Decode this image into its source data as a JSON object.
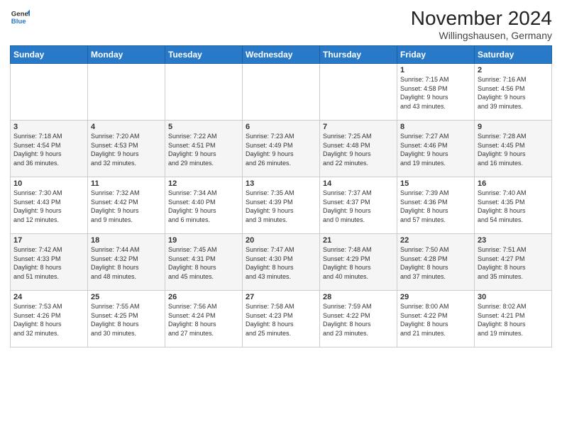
{
  "header": {
    "logo": {
      "general": "General",
      "blue": "Blue"
    },
    "title": "November 2024",
    "location": "Willingshausen, Germany"
  },
  "weekdays": [
    "Sunday",
    "Monday",
    "Tuesday",
    "Wednesday",
    "Thursday",
    "Friday",
    "Saturday"
  ],
  "weeks": [
    [
      {
        "day": "",
        "info": ""
      },
      {
        "day": "",
        "info": ""
      },
      {
        "day": "",
        "info": ""
      },
      {
        "day": "",
        "info": ""
      },
      {
        "day": "",
        "info": ""
      },
      {
        "day": "1",
        "info": "Sunrise: 7:15 AM\nSunset: 4:58 PM\nDaylight: 9 hours\nand 43 minutes."
      },
      {
        "day": "2",
        "info": "Sunrise: 7:16 AM\nSunset: 4:56 PM\nDaylight: 9 hours\nand 39 minutes."
      }
    ],
    [
      {
        "day": "3",
        "info": "Sunrise: 7:18 AM\nSunset: 4:54 PM\nDaylight: 9 hours\nand 36 minutes."
      },
      {
        "day": "4",
        "info": "Sunrise: 7:20 AM\nSunset: 4:53 PM\nDaylight: 9 hours\nand 32 minutes."
      },
      {
        "day": "5",
        "info": "Sunrise: 7:22 AM\nSunset: 4:51 PM\nDaylight: 9 hours\nand 29 minutes."
      },
      {
        "day": "6",
        "info": "Sunrise: 7:23 AM\nSunset: 4:49 PM\nDaylight: 9 hours\nand 26 minutes."
      },
      {
        "day": "7",
        "info": "Sunrise: 7:25 AM\nSunset: 4:48 PM\nDaylight: 9 hours\nand 22 minutes."
      },
      {
        "day": "8",
        "info": "Sunrise: 7:27 AM\nSunset: 4:46 PM\nDaylight: 9 hours\nand 19 minutes."
      },
      {
        "day": "9",
        "info": "Sunrise: 7:28 AM\nSunset: 4:45 PM\nDaylight: 9 hours\nand 16 minutes."
      }
    ],
    [
      {
        "day": "10",
        "info": "Sunrise: 7:30 AM\nSunset: 4:43 PM\nDaylight: 9 hours\nand 12 minutes."
      },
      {
        "day": "11",
        "info": "Sunrise: 7:32 AM\nSunset: 4:42 PM\nDaylight: 9 hours\nand 9 minutes."
      },
      {
        "day": "12",
        "info": "Sunrise: 7:34 AM\nSunset: 4:40 PM\nDaylight: 9 hours\nand 6 minutes."
      },
      {
        "day": "13",
        "info": "Sunrise: 7:35 AM\nSunset: 4:39 PM\nDaylight: 9 hours\nand 3 minutes."
      },
      {
        "day": "14",
        "info": "Sunrise: 7:37 AM\nSunset: 4:37 PM\nDaylight: 9 hours\nand 0 minutes."
      },
      {
        "day": "15",
        "info": "Sunrise: 7:39 AM\nSunset: 4:36 PM\nDaylight: 8 hours\nand 57 minutes."
      },
      {
        "day": "16",
        "info": "Sunrise: 7:40 AM\nSunset: 4:35 PM\nDaylight: 8 hours\nand 54 minutes."
      }
    ],
    [
      {
        "day": "17",
        "info": "Sunrise: 7:42 AM\nSunset: 4:33 PM\nDaylight: 8 hours\nand 51 minutes."
      },
      {
        "day": "18",
        "info": "Sunrise: 7:44 AM\nSunset: 4:32 PM\nDaylight: 8 hours\nand 48 minutes."
      },
      {
        "day": "19",
        "info": "Sunrise: 7:45 AM\nSunset: 4:31 PM\nDaylight: 8 hours\nand 45 minutes."
      },
      {
        "day": "20",
        "info": "Sunrise: 7:47 AM\nSunset: 4:30 PM\nDaylight: 8 hours\nand 43 minutes."
      },
      {
        "day": "21",
        "info": "Sunrise: 7:48 AM\nSunset: 4:29 PM\nDaylight: 8 hours\nand 40 minutes."
      },
      {
        "day": "22",
        "info": "Sunrise: 7:50 AM\nSunset: 4:28 PM\nDaylight: 8 hours\nand 37 minutes."
      },
      {
        "day": "23",
        "info": "Sunrise: 7:51 AM\nSunset: 4:27 PM\nDaylight: 8 hours\nand 35 minutes."
      }
    ],
    [
      {
        "day": "24",
        "info": "Sunrise: 7:53 AM\nSunset: 4:26 PM\nDaylight: 8 hours\nand 32 minutes."
      },
      {
        "day": "25",
        "info": "Sunrise: 7:55 AM\nSunset: 4:25 PM\nDaylight: 8 hours\nand 30 minutes."
      },
      {
        "day": "26",
        "info": "Sunrise: 7:56 AM\nSunset: 4:24 PM\nDaylight: 8 hours\nand 27 minutes."
      },
      {
        "day": "27",
        "info": "Sunrise: 7:58 AM\nSunset: 4:23 PM\nDaylight: 8 hours\nand 25 minutes."
      },
      {
        "day": "28",
        "info": "Sunrise: 7:59 AM\nSunset: 4:22 PM\nDaylight: 8 hours\nand 23 minutes."
      },
      {
        "day": "29",
        "info": "Sunrise: 8:00 AM\nSunset: 4:22 PM\nDaylight: 8 hours\nand 21 minutes."
      },
      {
        "day": "30",
        "info": "Sunrise: 8:02 AM\nSunset: 4:21 PM\nDaylight: 8 hours\nand 19 minutes."
      }
    ]
  ]
}
